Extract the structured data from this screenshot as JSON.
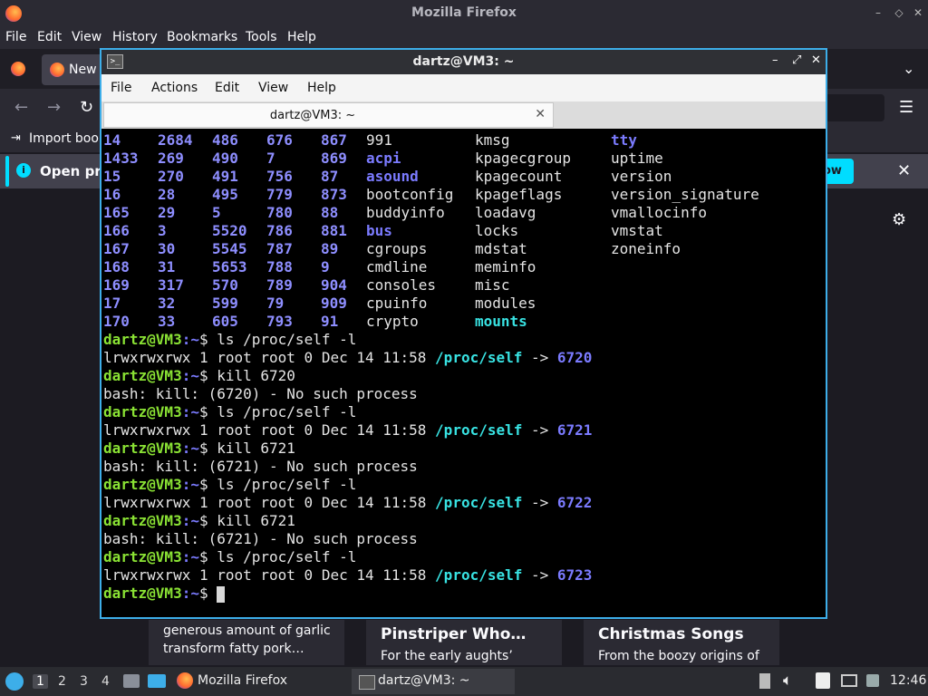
{
  "firefox": {
    "window_title": "Mozilla Firefox",
    "menu": [
      "File",
      "Edit",
      "View",
      "History",
      "Bookmarks",
      "Tools",
      "Help"
    ],
    "tab_label": "New",
    "bookmarks_label": "Import book",
    "infobar_text": "Open pre",
    "infobar_button": "ow",
    "cards": [
      {
        "heading": "",
        "line1": "generous amount of garlic",
        "line2": "transform fatty pork…"
      },
      {
        "heading": "Pinstriper Who…",
        "line1": "For the early aughts’",
        "line2": ""
      },
      {
        "heading": "Christmas Songs",
        "line1": "From the boozy origins of",
        "line2": ""
      }
    ]
  },
  "terminal": {
    "window_title": "dartz@VM3: ~",
    "tab_title": "dartz@VM3: ~",
    "menu": [
      "File",
      "Actions",
      "Edit",
      "View",
      "Help"
    ],
    "listing": [
      [
        "14",
        "2684",
        "486",
        "676",
        "867",
        "991",
        "kmsg",
        "tty"
      ],
      [
        "1433",
        "269",
        "490",
        "7",
        "869",
        "acpi",
        "kpagecgroup",
        "uptime"
      ],
      [
        "15",
        "270",
        "491",
        "756",
        "87",
        "asound",
        "kpagecount",
        "version"
      ],
      [
        "16",
        "28",
        "495",
        "779",
        "873",
        "bootconfig",
        "kpageflags",
        "version_signature"
      ],
      [
        "165",
        "29",
        "5",
        "780",
        "88",
        "buddyinfo",
        "loadavg",
        "vmallocinfo"
      ],
      [
        "166",
        "3",
        "5520",
        "786",
        "881",
        "bus",
        "locks",
        "vmstat"
      ],
      [
        "167",
        "30",
        "5545",
        "787",
        "89",
        "cgroups",
        "mdstat",
        "zoneinfo"
      ],
      [
        "168",
        "31",
        "5653",
        "788",
        "9",
        "cmdline",
        "meminfo",
        ""
      ],
      [
        "169",
        "317",
        "570",
        "789",
        "904",
        "consoles",
        "misc",
        ""
      ],
      [
        "17",
        "32",
        "599",
        "79",
        "909",
        "cpuinfo",
        "modules",
        ""
      ],
      [
        "170",
        "33",
        "605",
        "793",
        "91",
        "crypto",
        "mounts",
        ""
      ]
    ],
    "prompt_user": "dartz@VM3",
    "prompt_path": ":~",
    "prompt_sym": "$ ",
    "session": [
      {
        "cmd": "ls /proc/self -l",
        "out_prefix": "lrwxrwxrwx 1 root root 0 Dec 14 11:58 ",
        "link": "/proc/self",
        "arrow": " -> ",
        "target": "6720"
      },
      {
        "cmd": "kill 6720",
        "err": "bash: kill: (6720) - No such process"
      },
      {
        "cmd": "ls /proc/self -l",
        "out_prefix": "lrwxrwxrwx 1 root root 0 Dec 14 11:58 ",
        "link": "/proc/self",
        "arrow": " -> ",
        "target": "6721"
      },
      {
        "cmd": "kill 6721",
        "err": "bash: kill: (6721) - No such process"
      },
      {
        "cmd": "ls /proc/self -l",
        "out_prefix": "lrwxrwxrwx 1 root root 0 Dec 14 11:58 ",
        "link": "/proc/self",
        "arrow": " -> ",
        "target": "6722"
      },
      {
        "cmd": "kill 6721",
        "err": "bash: kill: (6721) - No such process"
      },
      {
        "cmd": "ls /proc/self -l",
        "out_prefix": "lrwxrwxrwx 1 root root 0 Dec 14 11:58 ",
        "link": "/proc/self",
        "arrow": " -> ",
        "target": "6723"
      }
    ]
  },
  "taskbar": {
    "workspaces": [
      "1",
      "2",
      "3",
      "4"
    ],
    "active_workspace": "1",
    "firefox_label": "Mozilla Firefox",
    "terminal_label": "dartz@VM3: ~",
    "clock": "12:46"
  },
  "colors": {
    "accent": "#3daee9",
    "prompt": "#8ae234",
    "dir": "#7b7bff",
    "link": "#38e2e2",
    "infobar_accent": "#00ddff"
  }
}
